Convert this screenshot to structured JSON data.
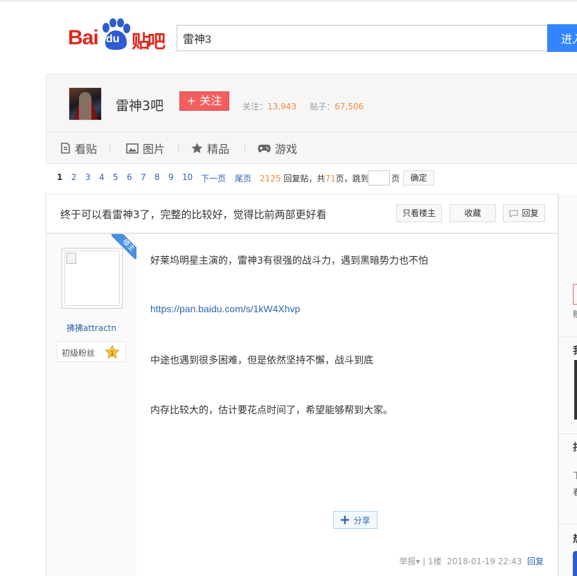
{
  "logo": {
    "bai": "Bai",
    "du": "du",
    "tieba": "贴吧"
  },
  "search": {
    "value": "雷神3",
    "button": "进入"
  },
  "forum": {
    "name": "雷神3吧",
    "follow": "+ 关注",
    "follow_label": "关注：",
    "follow_count": "13,943",
    "posts_label": "贴子：",
    "posts_count": "67,506",
    "tabs": [
      {
        "label": "看贴",
        "icon": "document-icon"
      },
      {
        "label": "图片",
        "icon": "image-icon"
      },
      {
        "label": "精品",
        "icon": "star-icon"
      },
      {
        "label": "游戏",
        "icon": "gamepad-icon"
      }
    ]
  },
  "pager": {
    "pages": [
      "1",
      "2",
      "3",
      "4",
      "5",
      "6",
      "7",
      "8",
      "9",
      "10"
    ],
    "next": "下一页",
    "last": "尾页",
    "replies": "2125",
    "replies_suffix": "回复贴，共",
    "total_pages": "71",
    "jump_text": "页，跳到",
    "page_unit": "页",
    "confirm": "确定"
  },
  "thread": {
    "title": "终于可以看雷神3了，完整的比较好，觉得比前两部更好看",
    "only_op": "只看楼主",
    "favorite": "收藏",
    "reply": "回复"
  },
  "post": {
    "badge": "楼主",
    "author": "拂拂attractn",
    "level": "初级粉丝",
    "level_num": "1",
    "lines": [
      "好莱坞明星主演的，雷神3有很强的战斗力，遇到黑暗势力也不怕",
      "https://pan.baidu.com/s/1kW4Xhvp",
      "中途也遇到很多困难，但是依然坚持不懈，战斗到底",
      "内存比较大的，估计要花点时间了，希望能够帮到大家。"
    ],
    "share": "分享",
    "report": "举报",
    "floor": "1楼",
    "time": "2018-01-19 22:43",
    "reply_link": "回复"
  },
  "sidebar": {
    "chars": [
      "赚",
      "我",
      "扫",
      "下",
      "看",
      "热"
    ]
  },
  "colors": {
    "accent": "#3385ff",
    "brand": "#e1251b",
    "link": "#2d64b3",
    "follow": "#f45e5e",
    "count": "#f08a3e"
  }
}
